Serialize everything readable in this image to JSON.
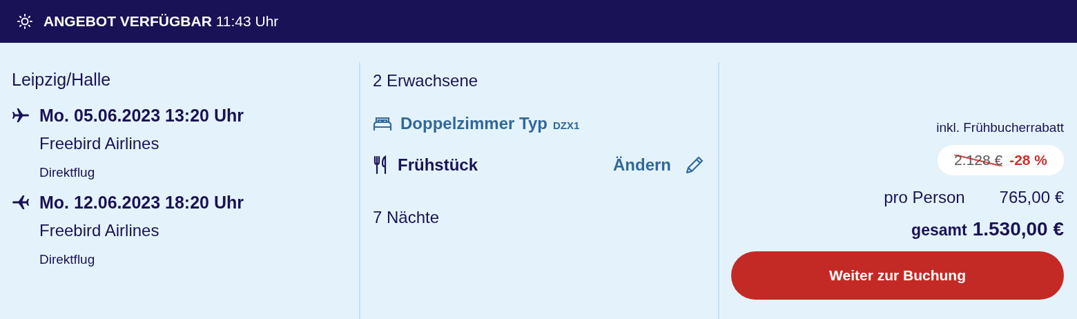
{
  "header": {
    "title": "ANGEBOT VERFÜGBAR",
    "time": "11:43 Uhr"
  },
  "departure_airport": "Leipzig/Halle",
  "flights": [
    {
      "kind": "outbound",
      "datetime": "Mo. 05.06.2023 13:20 Uhr",
      "airline": "Freebird Airlines",
      "type": "Direktflug"
    },
    {
      "kind": "return",
      "datetime": "Mo. 12.06.2023 18:20 Uhr",
      "airline": "Freebird Airlines",
      "type": "Direktflug"
    }
  ],
  "travellers": "2 Erwachsene",
  "room": {
    "name": "Doppelzimmer Typ",
    "code": "DZX1"
  },
  "board": {
    "name": "Frühstück",
    "change_link": "Ändern"
  },
  "nights": "7 Nächte",
  "price": {
    "note": "inkl. Frühbucherrabatt",
    "old_price": "2.128 €",
    "discount": "-28 %",
    "per_person_label": "pro Person",
    "per_person": "765,00 €",
    "total_label": "gesamt",
    "total": "1.530,00 €",
    "button": "Weiter zur Buchung"
  }
}
